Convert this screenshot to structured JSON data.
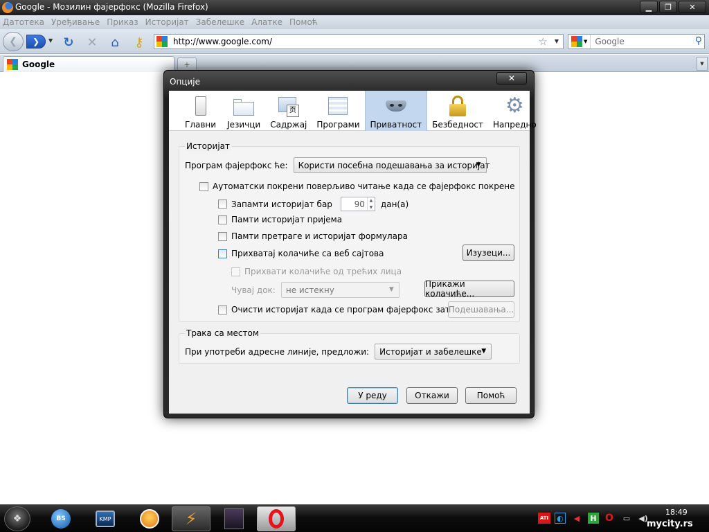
{
  "window": {
    "title": "Google - Мозилин фајерфокс (Mozilla Firefox)",
    "controls": {
      "minimize": "▁",
      "maximize": "❐",
      "close": "✕"
    }
  },
  "menubar": [
    "Датотека",
    "Уређивање",
    "Приказ",
    "Историјат",
    "Забелешке",
    "Алатке",
    "Помоћ"
  ],
  "toolbar": {
    "url": "http://www.google.com/",
    "search_placeholder": "Google"
  },
  "tabs": [
    {
      "title": "Google"
    }
  ],
  "dialog": {
    "title": "Опције",
    "close": "✕",
    "panes": [
      "Главни",
      "Језичци",
      "Садржај",
      "Програми",
      "Приватност",
      "Безбедност",
      "Напредно"
    ],
    "active_pane": "Приватност",
    "history": {
      "caption": "Историјат",
      "mode_label": "Програм фајерфокс ће:",
      "mode_value": "Користи посебна подешавања за историјат",
      "auto_private": "Аутоматски покрени поверљиво читање када се фајерфокс покрене",
      "remember_history": "Запамти историјат бар",
      "days_value": "90",
      "days_unit": "дан(а)",
      "remember_downloads": "Памти историјат пријема",
      "remember_forms": "Памти претраге и историјат формулара",
      "accept_cookies": "Прихватај колачиће са веб сајтова",
      "exceptions_button": "Изузеци...",
      "third_party": "Прихвати колачиће од трећих лица",
      "keep_until_label": "Чувај док:",
      "keep_until_value": "не истекну",
      "show_cookies_button": "Прикажи колачиће...",
      "clear_on_close": "Очисти историјат када се програм фајерфокс затвори",
      "settings_button": "Подешавања..."
    },
    "location_bar": {
      "caption": "Трака са местом",
      "suggest_label": "При употреби адресне линије, предложи:",
      "suggest_value": "Историјат и забелешке"
    },
    "buttons": {
      "ok": "У реду",
      "cancel": "Откажи",
      "help": "Помоћ"
    }
  },
  "taskbar": {
    "clock": "18:49",
    "watermark": "mycity.rs"
  }
}
